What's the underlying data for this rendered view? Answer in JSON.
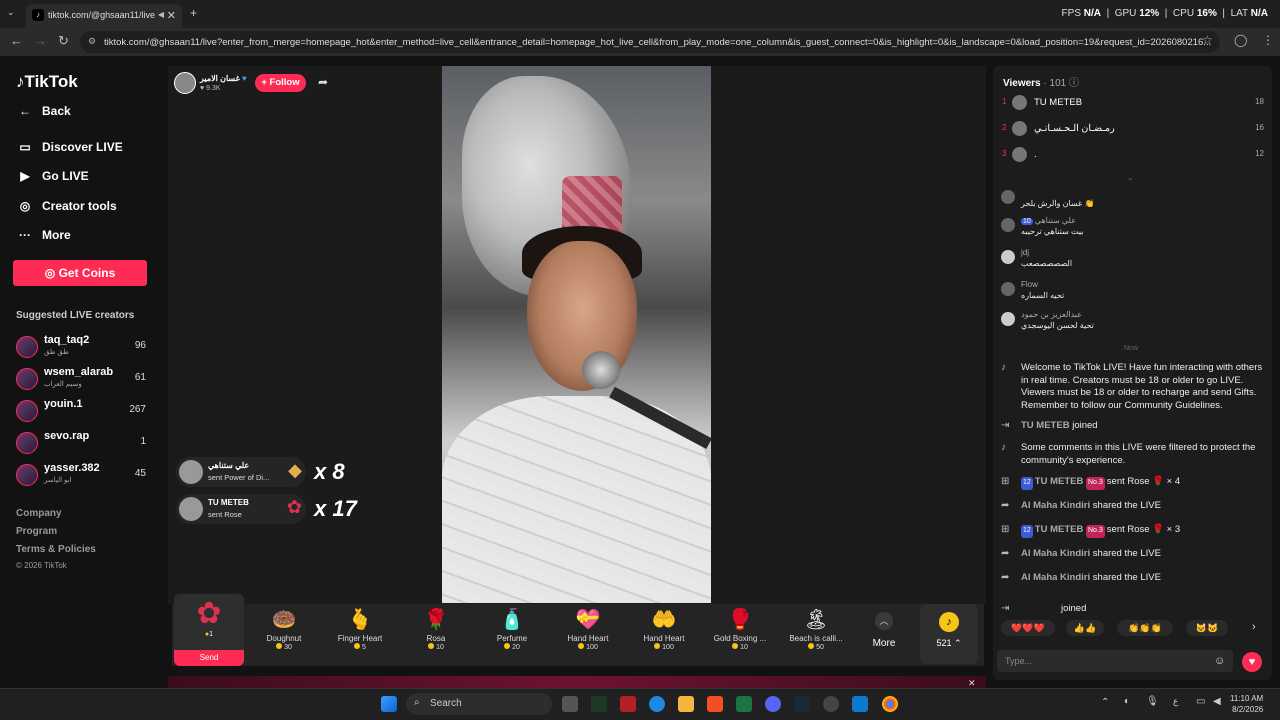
{
  "browser": {
    "tab_title": "tiktok.com/@ghsaan11/live",
    "url": "tiktok.com/@ghsaan11/live?enter_from_merge=homepage_hot&enter_method=live_cell&entrance_detail=homepage_hot_live_cell&from_play_mode=one_column&is_guest_connect=0&is_highlight=0&is_landscape=0&load_position=19&request_id=2026080216...",
    "hud": {
      "fps_label": "FPS",
      "fps": "N/A",
      "gpu_label": "GPU",
      "gpu": "12%",
      "cpu_label": "CPU",
      "cpu": "16%",
      "lat_label": "LAT",
      "lat": "N/A"
    }
  },
  "sidebar": {
    "logo": "TikTok",
    "back": "Back",
    "items": [
      {
        "label": "Discover LIVE",
        "icon": "tv-icon"
      },
      {
        "label": "Go LIVE",
        "icon": "video-camera-icon"
      },
      {
        "label": "Creator tools",
        "icon": "lightbulb-icon"
      },
      {
        "label": "More",
        "icon": "ellipsis-icon"
      }
    ],
    "get_coins": "Get Coins",
    "suggested_title": "Suggested LIVE creators",
    "suggested": [
      {
        "name": "taq_taq2",
        "sub": "طق طق",
        "count": "96"
      },
      {
        "name": "wsem_alarab",
        "sub": "وسيم العراب",
        "count": "61"
      },
      {
        "name": "youin.1",
        "sub": "",
        "count": "267"
      },
      {
        "name": "sevo.rap",
        "sub": "",
        "count": "1"
      },
      {
        "name": "yasser.382",
        "sub": "ابو الياسر",
        "count": "45"
      }
    ],
    "footer": [
      "Company",
      "Program",
      "Terms & Policies",
      "© 2026 TikTok"
    ]
  },
  "host": {
    "name": "غسان الامير",
    "likes": "9.3K",
    "follow": "+ Follow"
  },
  "gift_notifications": [
    {
      "user": "علي ستناهي",
      "text": "sent Power of Di...",
      "count": "x 8",
      "icon": "diamond-icon"
    },
    {
      "user": "TU METEB",
      "text": "sent Rose",
      "count": "x 17",
      "icon": "rose-icon"
    }
  ],
  "gift_bar": {
    "selected": {
      "price": "1",
      "send": "Send"
    },
    "gifts": [
      {
        "name": "Doughnut",
        "price": "30",
        "glyph": "🍩"
      },
      {
        "name": "Finger Heart",
        "price": "5",
        "glyph": "🫰"
      },
      {
        "name": "Rosa",
        "price": "10",
        "glyph": "🌹"
      },
      {
        "name": "Perfume",
        "price": "20",
        "glyph": "🧴"
      },
      {
        "name": "Hand Heart",
        "price": "100",
        "glyph": "💝"
      },
      {
        "name": "Hand Heart",
        "price": "100",
        "glyph": "🤲"
      },
      {
        "name": "Gold Boxing ...",
        "price": "10",
        "glyph": "🥊"
      },
      {
        "name": "Beach is calli...",
        "price": "50",
        "glyph": "🏝"
      }
    ],
    "more": "More",
    "coins": "521"
  },
  "viewers": {
    "title": "Viewers",
    "count": "· 101",
    "list": [
      {
        "rank": "1",
        "name": "TU METEB",
        "score": "18"
      },
      {
        "rank": "2",
        "name": "رمـضـان الـحـسـانـي",
        "score": "16"
      },
      {
        "rank": "3",
        "name": ".",
        "score": "12"
      }
    ]
  },
  "comments": [
    {
      "user": "",
      "text": "غسان والرش بلحر 👏"
    },
    {
      "user": "علي ستناهي",
      "text": "بيت ستناهي ترحيبه"
    },
    {
      "user": "jdj",
      "text": "الصصصصصعب"
    },
    {
      "user": "Flow",
      "text": "تحيه السماره"
    },
    {
      "user": "عبدالعزيز بن حمود",
      "text": "تحية لحسن اليوسجدي"
    }
  ],
  "now_label": "Now",
  "system_messages": {
    "welcome": "Welcome to TikTok LIVE! Have fun interacting with others in real time. Creators must be 18 or older to go LIVE. Viewers must be 18 or older to recharge and send Gifts. Remember to follow our Community Guidelines.",
    "joined_user": "TU METEB",
    "joined_text": "joined",
    "filtered": "Some comments in this LIVE were filtered to protect the community's experience.",
    "events": [
      {
        "user": "TU METEB",
        "level": "12",
        "rank": "No.3",
        "text": "sent Rose 🌹 × 4"
      },
      {
        "user": "Al Maha Kindiri",
        "text": "shared the LIVE"
      },
      {
        "user": "TU METEB",
        "level": "12",
        "rank": "No.3",
        "text": "sent Rose 🌹 × 3"
      },
      {
        "user": "Al Maha Kindiri",
        "text": "shared the LIVE"
      },
      {
        "user": "Al Maha Kindiri",
        "text": "shared the LIVE"
      }
    ],
    "last_joined": "joined"
  },
  "reactions": [
    "❤️❤️❤️",
    "👍👍",
    "👏👏👏",
    "🐱🐱"
  ],
  "chat_input": {
    "placeholder": "Type..."
  },
  "taskbar": {
    "search": "Search",
    "time": "11:10 AM",
    "date": "8/2/2026"
  }
}
